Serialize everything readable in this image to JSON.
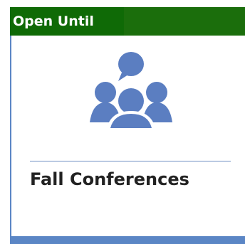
{
  "tile": {
    "header_label": "Open Until",
    "title": "Fall Conferences",
    "icon": "people-conversation-icon"
  },
  "colors": {
    "header_green": "#0f6a06",
    "header_green_bar": "#1b6e0c",
    "accent_blue": "#5b86c5",
    "divider_blue": "#6f8fc3",
    "icon_blue": "#5b7ec1",
    "text_dark": "#222222"
  }
}
